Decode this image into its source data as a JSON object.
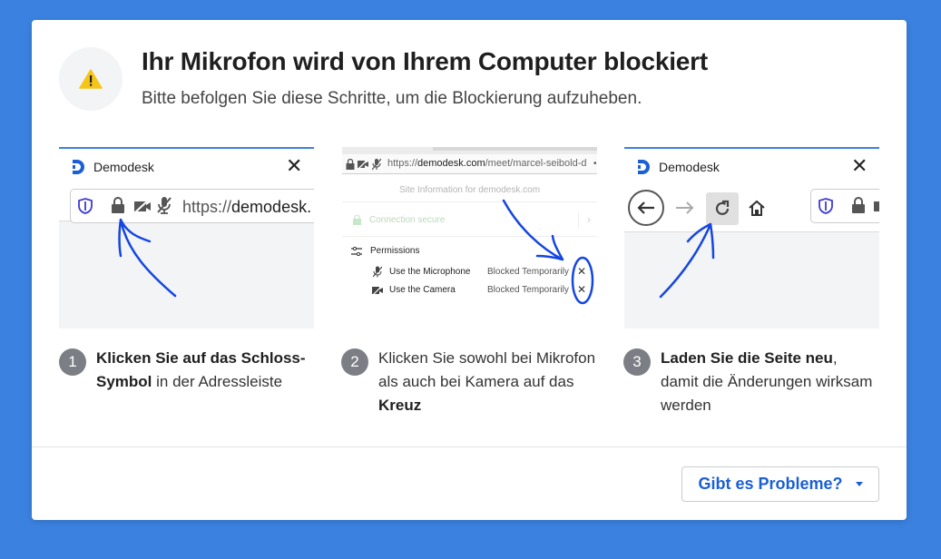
{
  "dialog": {
    "title": "Ihr Mikrofon wird von Ihrem Computer blockiert",
    "subtitle": "Bitte befolgen Sie diese Schritte, um die Blockierung aufzuheben.",
    "icon": "warning-icon"
  },
  "shot1": {
    "tab_title": "Demodesk",
    "url_prefix": "https://",
    "url_host": "demodesk."
  },
  "shot2": {
    "url_prefix": "https://",
    "url_host": "demodesk.com",
    "url_path": "/meet/marcel-seibold-d",
    "site_info": "Site Information for demodesk.com",
    "connection": "Connection secure",
    "permissions_label": "Permissions",
    "permissions": [
      {
        "label": "Use the Microphone",
        "status": "Blocked Temporarily"
      },
      {
        "label": "Use the Camera",
        "status": "Blocked Temporarily"
      }
    ]
  },
  "shot3": {
    "tab_title": "Demodesk"
  },
  "steps": [
    {
      "num": "1",
      "bold1": "Klicken Sie auf das Schloss-Symbol",
      "text1": " in der Adressleiste"
    },
    {
      "num": "2",
      "text1": "Klicken Sie sowohl bei Mikrofon als auch bei Kamera auf das ",
      "bold1": "Kreuz"
    },
    {
      "num": "3",
      "bold1": "Laden Sie die Seite neu",
      "text1": ", damit die Änderungen wirksam werden"
    }
  ],
  "footer": {
    "help_label": "Gibt es Probleme?"
  },
  "colors": {
    "background": "#3b82e0",
    "accent": "#1a5fd6",
    "annotation": "#1546e0",
    "warning": "#f5c518"
  }
}
